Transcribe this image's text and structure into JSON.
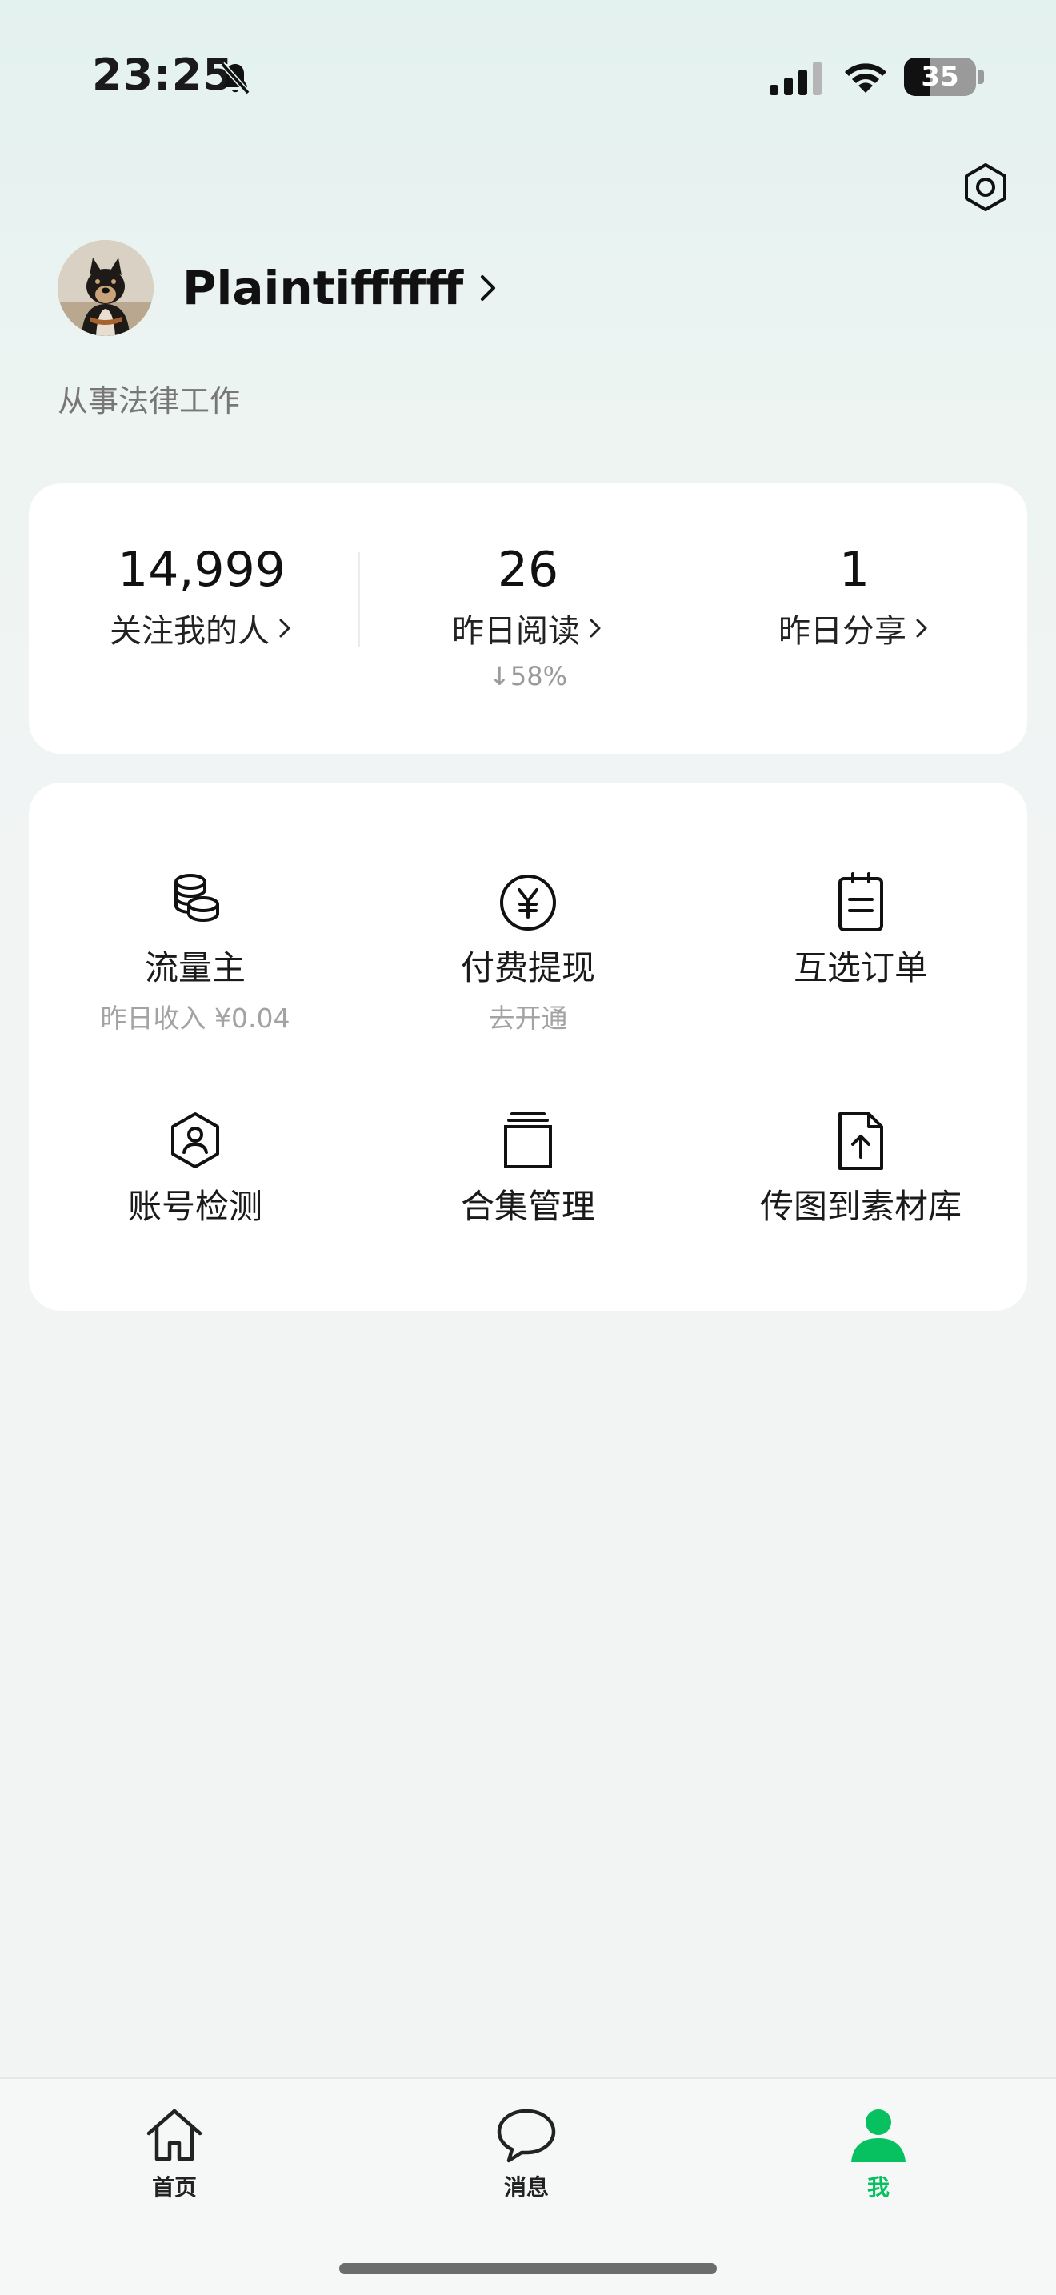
{
  "status_bar": {
    "time": "23:25",
    "battery_level": "35",
    "icons": [
      "bell-slash-icon",
      "signal-icon",
      "wifi-icon",
      "battery-icon"
    ]
  },
  "header": {
    "settings_icon": "hexagon-settings-icon"
  },
  "profile": {
    "name": "Plaintiffffff",
    "bio": "从事法律工作"
  },
  "stats": [
    {
      "value": "14,999",
      "label": "关注我的人",
      "sub": ""
    },
    {
      "value": "26",
      "label": "昨日阅读",
      "sub": "↓58%"
    },
    {
      "value": "1",
      "label": "昨日分享",
      "sub": ""
    }
  ],
  "menu": [
    {
      "label": "流量主",
      "sub": "昨日收入 ¥0.04",
      "icon": "coins-icon"
    },
    {
      "label": "付费提现",
      "sub": "去开通",
      "icon": "yen-icon"
    },
    {
      "label": "互选订单",
      "sub": "",
      "icon": "clipboard-icon"
    },
    {
      "label": "账号检测",
      "sub": "",
      "icon": "shield-user-icon"
    },
    {
      "label": "合集管理",
      "sub": "",
      "icon": "folder-stack-icon"
    },
    {
      "label": "传图到素材库",
      "sub": "",
      "icon": "upload-file-icon"
    }
  ],
  "tabs": [
    {
      "label": "首页",
      "icon": "home-icon",
      "active": false
    },
    {
      "label": "消息",
      "icon": "chat-bubble-icon",
      "active": false
    },
    {
      "label": "我",
      "icon": "person-icon",
      "active": true
    }
  ],
  "colors": {
    "accent": "#07c160",
    "card": "#ffffff",
    "muted_text": "#9a9a9a"
  }
}
